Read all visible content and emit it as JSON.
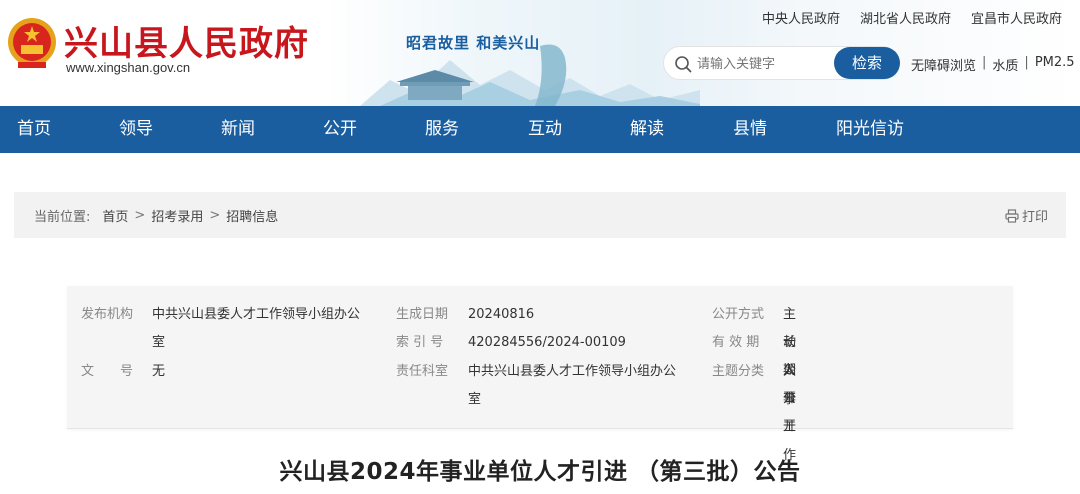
{
  "header": {
    "site_name": "兴山县人民政府",
    "site_url": "www.xingshan.gov.cn",
    "slogan": "昭君故里 和美兴山",
    "top_links": [
      "中央人民政府",
      "湖北省人民政府",
      "宜昌市人民政府"
    ],
    "search": {
      "placeholder": "请输入关键字",
      "button": "检索"
    },
    "util_links": [
      "无障碍浏览",
      "水质",
      "PM2.5"
    ],
    "separator": "|"
  },
  "nav": {
    "items": [
      "首页",
      "领导",
      "新闻",
      "公开",
      "服务",
      "互动",
      "解读",
      "县情",
      "阳光信访"
    ]
  },
  "breadcrumb": {
    "label": "当前位置:",
    "items": [
      "首页",
      "招考录用",
      "招聘信息"
    ],
    "arrow": ">",
    "print": "打印"
  },
  "info": {
    "publisher_key": "发布机构",
    "publisher_line1": "中共兴山县委人才工作领导小组办公",
    "publisher_line2": "室",
    "doc_no_key": "文　　号",
    "doc_no": "无",
    "date_key": "生成日期",
    "date": "20240816",
    "index_key": "索 引 号",
    "index": "420284556/2024-00109",
    "office_key": "责任科室",
    "office_line1": "中共兴山县委人才工作领导小组办公",
    "office_line2": "室",
    "mode_key": "公开方式",
    "mode": "主动公开",
    "validity_key": "有 效 期",
    "validity": "长期公开",
    "topic_key": "主题分类",
    "topic": "人事工作"
  },
  "article": {
    "title": "兴山县2024年事业单位人才引进 （第三批）公告"
  },
  "colors": {
    "brand_red": "#c8161d",
    "nav_blue": "#1a5ea0"
  }
}
